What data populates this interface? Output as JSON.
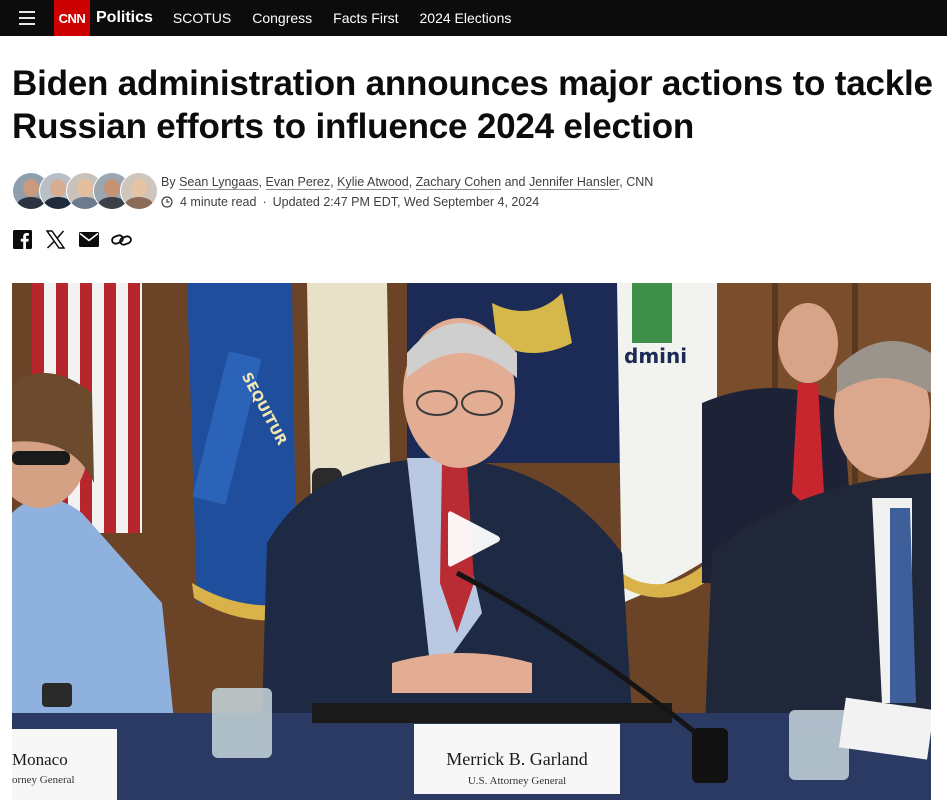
{
  "nav": {
    "logo": "CNN",
    "section": "Politics",
    "links": [
      "SCOTUS",
      "Congress",
      "Facts First",
      "2024 Elections"
    ]
  },
  "article": {
    "headline": "Biden administration announces major actions to tackle Russian efforts to influence 2024 election",
    "byline": {
      "prefix": "By",
      "authors": [
        "Sean Lyngaas",
        "Evan Perez",
        "Kylie Atwood",
        "Zachary Cohen",
        "Jennifer Hansler"
      ],
      "separator": ",",
      "and": "and",
      "source": "CNN"
    },
    "read_time": "4 minute read",
    "updated": "Updated 2:47 PM EDT, Wed September 4, 2024"
  },
  "share": [
    "facebook-icon",
    "x-icon",
    "email-icon",
    "link-icon"
  ],
  "video": {
    "placard_center_name": "Merrick B. Garland",
    "placard_center_title": "U.S. Attorney General",
    "placard_left_name": "Monaco",
    "placard_left_title": "orney General",
    "flag_text_left": "SEQUITUR",
    "flag_text_right": "dmini"
  },
  "colors": {
    "nav_bg": "#0c0c0c",
    "brand_red": "#cc0000",
    "text": "#0c0c0c",
    "meta_text": "#404040"
  }
}
